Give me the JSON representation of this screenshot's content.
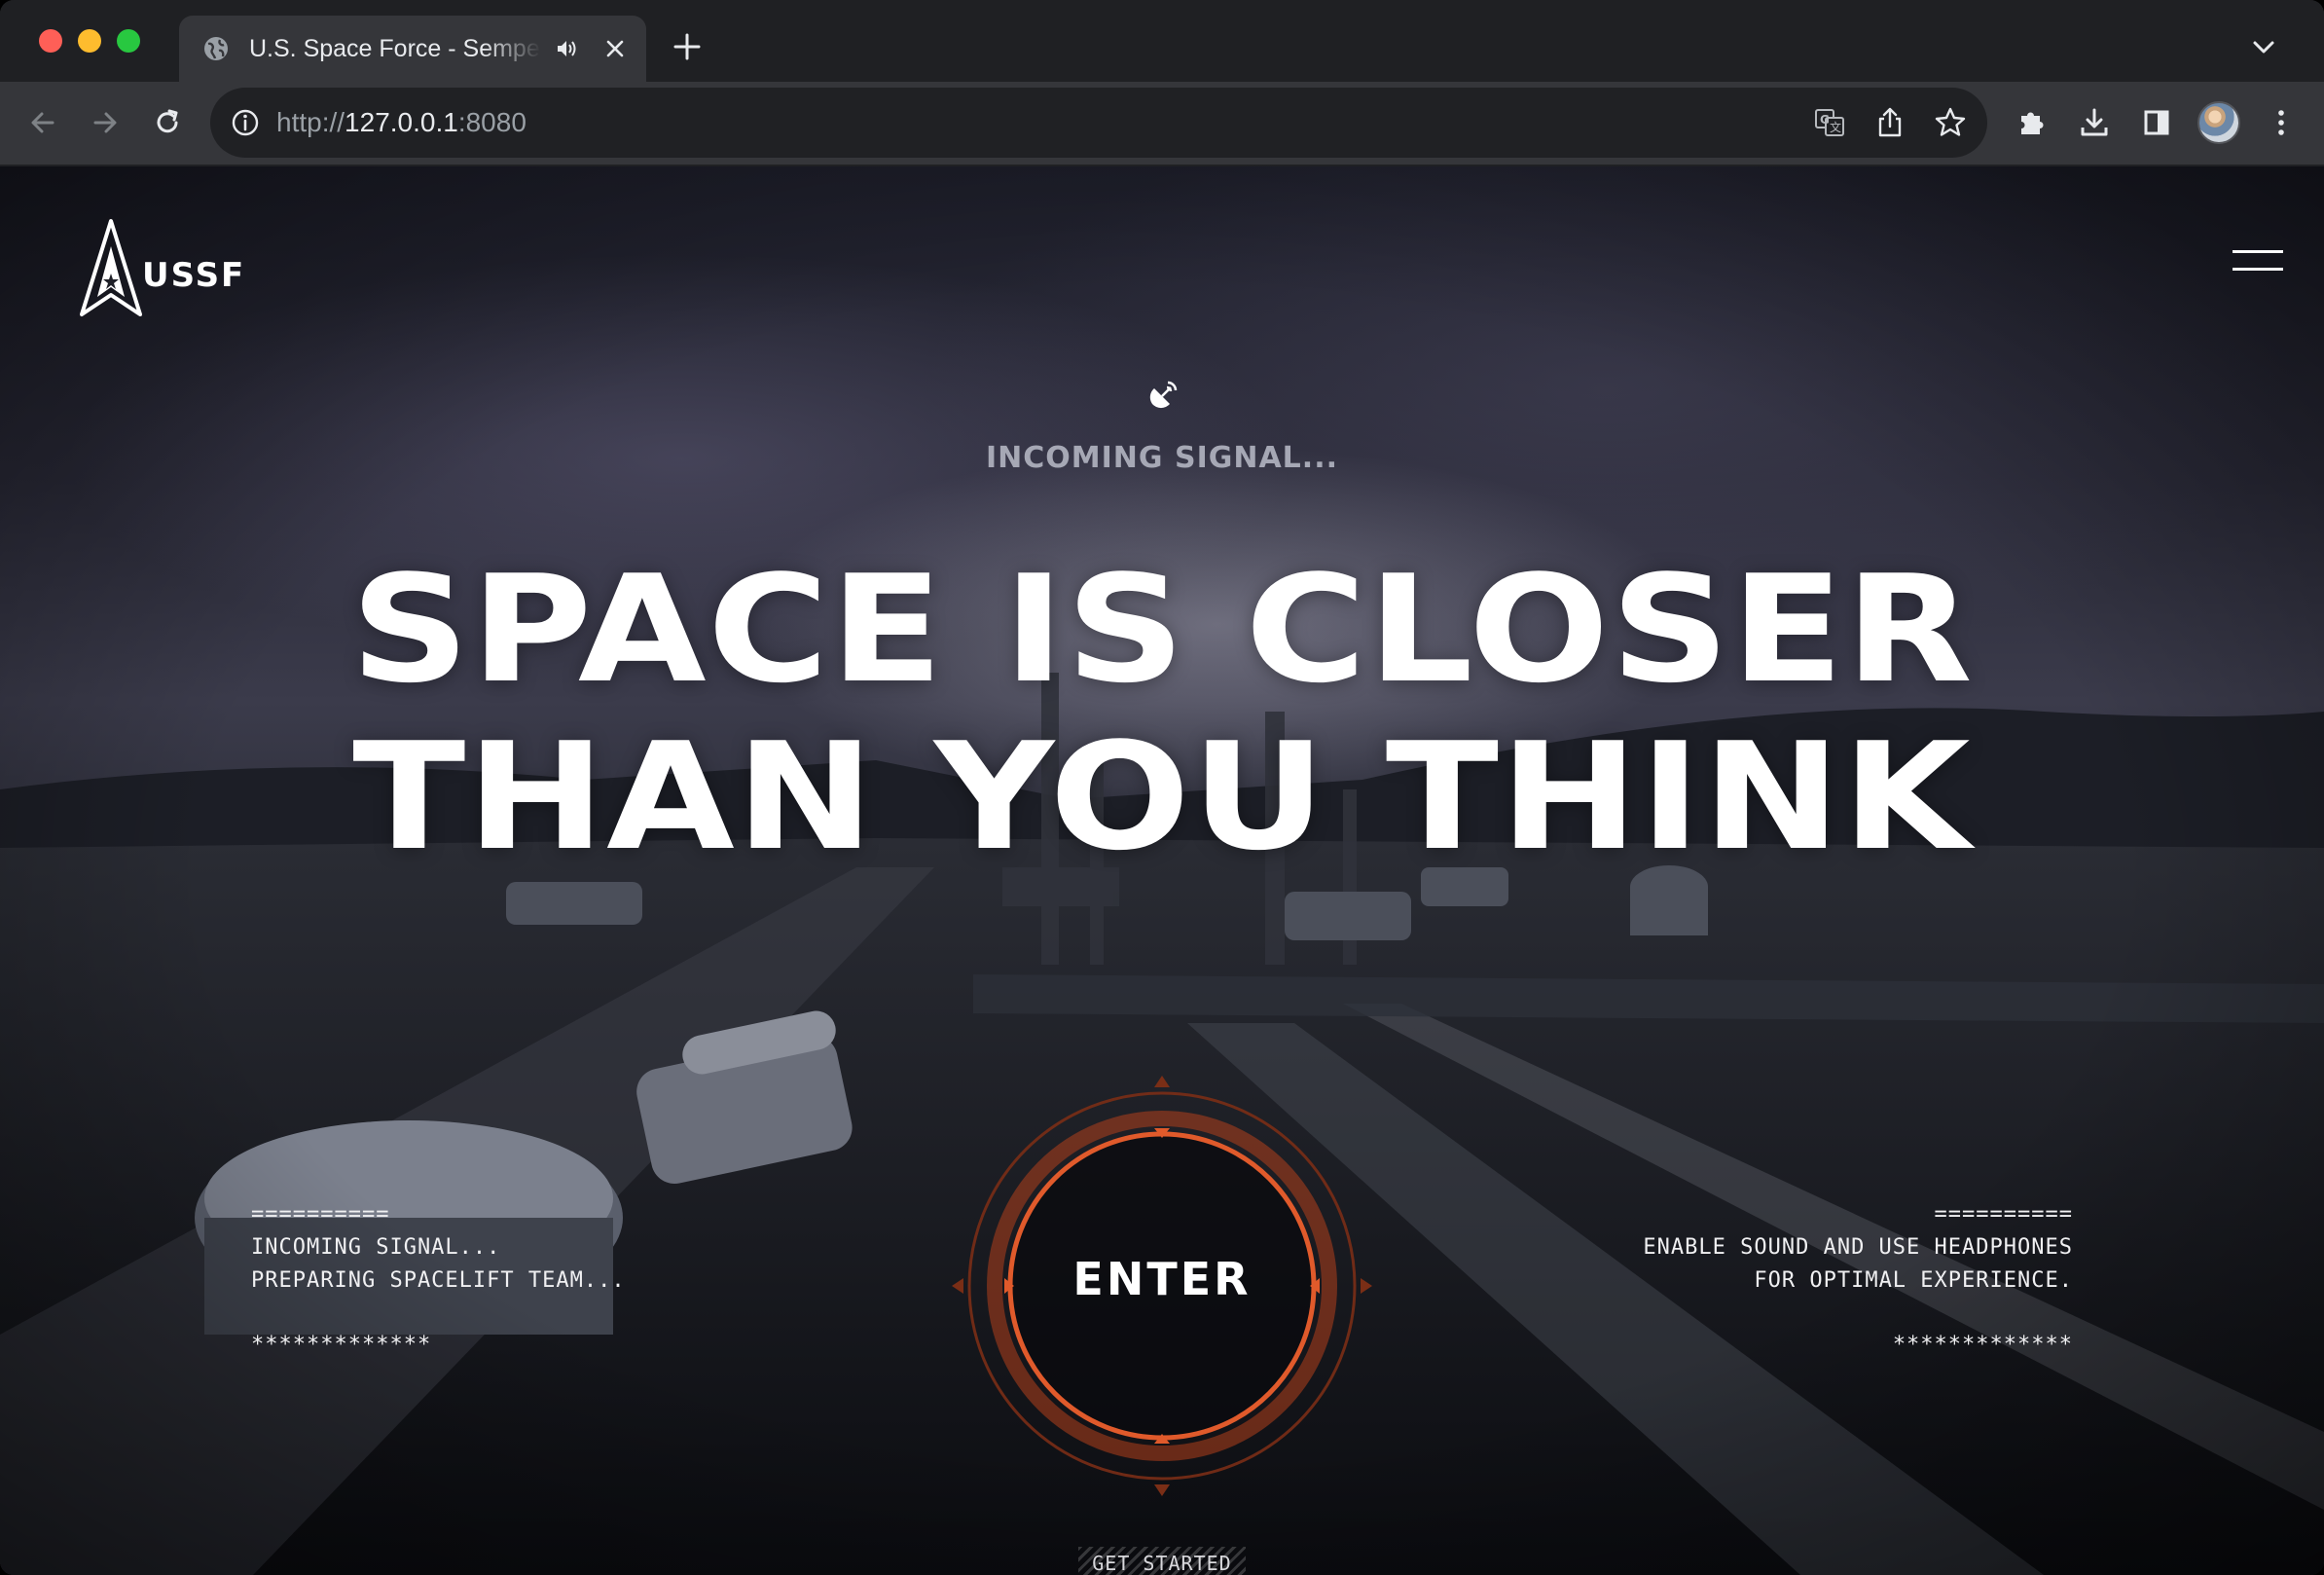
{
  "browser": {
    "tab": {
      "title": "U.S. Space Force - Semper Supra"
    },
    "url": {
      "scheme": "http://",
      "host": "127.0.0.1",
      "port": ":8080"
    }
  },
  "header": {
    "logo_text": "USSF"
  },
  "hero": {
    "signal_status": "INCOMING SIGNAL...",
    "headline_line1": "SPACE IS CLOSER",
    "headline_line2": "THAN YOU THINK"
  },
  "left_panel": {
    "divider": "==========",
    "line1": "INCOMING SIGNAL...",
    "line2": "PREPARING SPACELIFT TEAM...",
    "stars": "*************"
  },
  "right_panel": {
    "divider": "==========",
    "line1": "ENABLE SOUND AND USE HEADPHONES",
    "line2": "FOR OPTIMAL EXPERIENCE.",
    "stars": "*************"
  },
  "enter_button": {
    "label": "ENTER"
  },
  "get_started": {
    "label": "GET STARTED"
  },
  "colors": {
    "accent": "#e05a2b",
    "ring": "#c44a22",
    "chrome_bg": "#35363a"
  }
}
